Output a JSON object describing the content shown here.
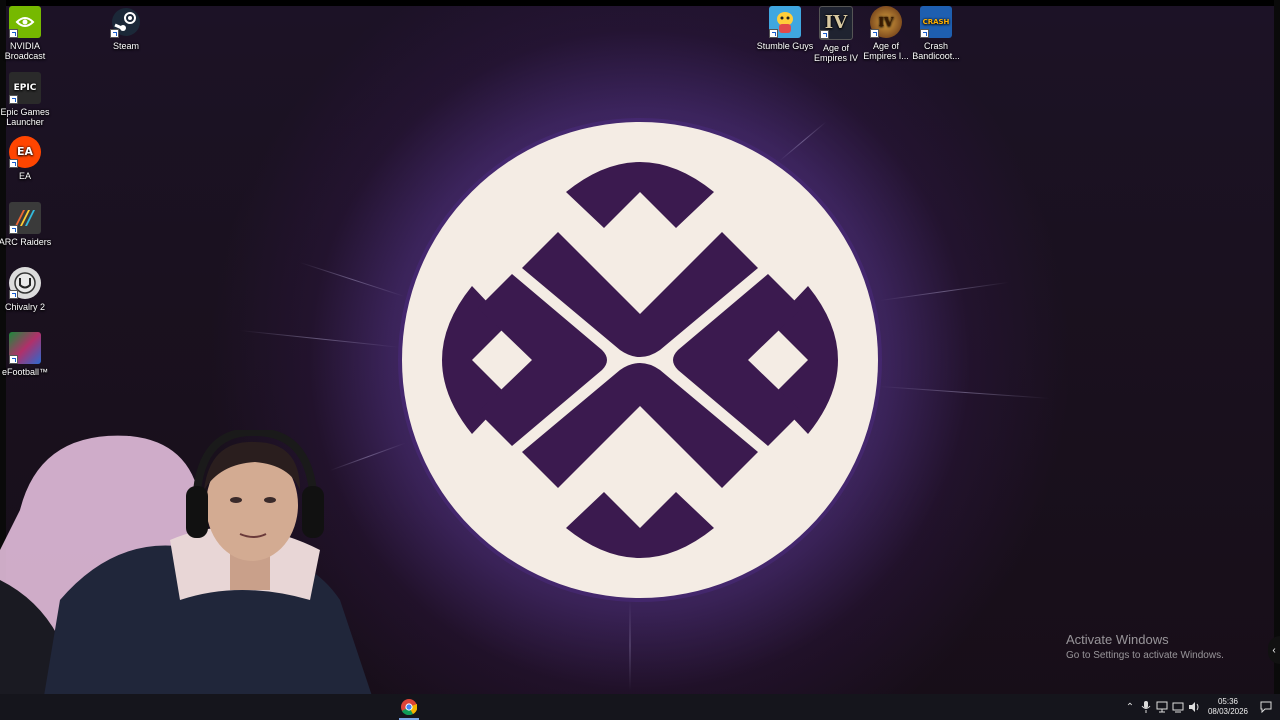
{
  "desktop": {
    "icons_left": [
      {
        "label": "NVIDIA Broadcast",
        "icon": "nvidia-icon",
        "color": "#76b900"
      },
      {
        "label": "Epic Games Launcher",
        "icon": "epic-games-icon",
        "color": "#2a2a2a",
        "glyph": "EPIC"
      },
      {
        "label": "EA",
        "icon": "ea-icon",
        "color": "#ff4500",
        "glyph": "EA"
      },
      {
        "label": "ARC Raiders",
        "icon": "arc-raiders-icon",
        "color": "#3a3a3a"
      },
      {
        "label": "Chivalry 2",
        "icon": "chivalry-icon",
        "color": "#dddddd"
      },
      {
        "label": "eFootball™",
        "icon": "efootball-icon",
        "color": "#1a8a3a"
      }
    ],
    "icon_steam": {
      "label": "Steam",
      "icon": "steam-icon",
      "color": "#1b2838"
    },
    "icons_top": [
      {
        "label": "Stumble Guys",
        "icon": "stumble-guys-icon",
        "color": "#3fa7e0"
      },
      {
        "label": "Age of Empires IV",
        "icon": "age-of-empires-iv-icon",
        "color": "#1f2330",
        "glyph": "IV"
      },
      {
        "label": "Age of Empires I...",
        "icon": "age-of-empires-icon",
        "color": "#4a2a10",
        "glyph": "IV"
      },
      {
        "label": "Crash Bandicoot...",
        "icon": "crash-bandicoot-icon",
        "color": "#1e5fb0",
        "glyph": "CRASH"
      }
    ]
  },
  "watermark": {
    "title": "Activate Windows",
    "subtitle": "Go to Settings to activate Windows."
  },
  "taskbar": {
    "pinned": [
      {
        "icon": "chrome-icon"
      }
    ],
    "tray_icons": [
      "chevron-up-icon",
      "microphone-icon",
      "network-icon",
      "wifi-icon",
      "volume-icon"
    ],
    "clock_time": "05:36",
    "clock_date": "08/03/2026",
    "notification_icon": "notification-icon"
  },
  "colors": {
    "logo_disc": "#f4ece4",
    "logo_mark": "#3b1a4f",
    "glow": "#a778ff"
  }
}
